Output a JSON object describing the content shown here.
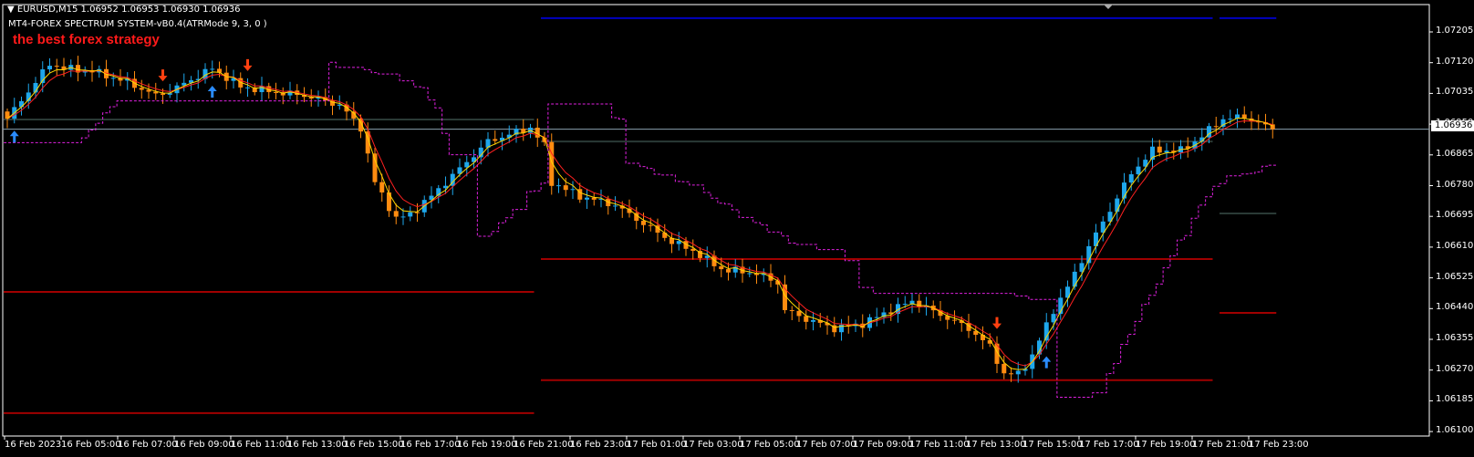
{
  "header": {
    "symbol_line": "EURUSD,M15  1.06952 1.06953 1.06930 1.06936",
    "indicator_line": "MT4-FOREX SPECTRUM SYSTEM-vB0.4(ATRMode 9, 3, 0 )",
    "promo_text": "the best forex strategy"
  },
  "current_price": "1.06936",
  "colors": {
    "background": "#000000",
    "bull": "#1ea7ec",
    "bear": "#ff8c10",
    "ma_fast": "#ffd700",
    "ma_slow": "#ff2020",
    "band": "#e020e0",
    "level_blue": "#0000c0",
    "level_red": "#a00000",
    "level_gray": "#2a3a36",
    "price_line": "#8aa0b0",
    "arrow_up": "#2a8cff",
    "arrow_down": "#ff4010"
  },
  "chart_data": {
    "type": "candlestick",
    "title": "EURUSD,M15",
    "bar_count": 180,
    "ylim": [
      1.061,
      1.07205
    ],
    "y_ticks": [
      "1.07205",
      "1.07120",
      "1.07035",
      "1.06950",
      "1.06865",
      "1.06780",
      "1.06695",
      "1.06610",
      "1.06525",
      "1.06440",
      "1.06355",
      "1.06270",
      "1.06185",
      "1.06100"
    ],
    "x_ticks": [
      "16 Feb 2023",
      "16 Feb 05:00",
      "16 Feb 07:00",
      "16 Feb 09:00",
      "16 Feb 11:00",
      "16 Feb 13:00",
      "16 Feb 15:00",
      "16 Feb 17:00",
      "16 Feb 19:00",
      "16 Feb 21:00",
      "16 Feb 23:00",
      "17 Feb 01:00",
      "17 Feb 03:00",
      "17 Feb 05:00",
      "17 Feb 07:00",
      "17 Feb 09:00",
      "17 Feb 11:00",
      "17 Feb 13:00",
      "17 Feb 15:00",
      "17 Feb 17:00",
      "17 Feb 19:00",
      "17 Feb 21:00",
      "17 Feb 23:00"
    ],
    "close_path": [
      [
        0,
        1.06965
      ],
      [
        6,
        1.07117
      ],
      [
        8,
        1.07104
      ],
      [
        12,
        1.07097
      ],
      [
        17,
        1.07066
      ],
      [
        21,
        1.07029
      ],
      [
        23,
        1.07041
      ],
      [
        29,
        1.07104
      ],
      [
        33,
        1.07054
      ],
      [
        37,
        1.07041
      ],
      [
        42,
        1.07029
      ],
      [
        47,
        1.07003
      ],
      [
        50,
        1.0694
      ],
      [
        52,
        1.06789
      ],
      [
        55,
        1.06688
      ],
      [
        57,
        1.06701
      ],
      [
        60,
        1.06751
      ],
      [
        64,
        1.06827
      ],
      [
        68,
        1.06902
      ],
      [
        72,
        1.06928
      ],
      [
        74,
        1.0694
      ],
      [
        76,
        1.0689
      ],
      [
        77,
        1.06789
      ],
      [
        81,
        1.06751
      ],
      [
        86,
        1.06726
      ],
      [
        90,
        1.06675
      ],
      [
        94,
        1.06625
      ],
      [
        97,
        1.066
      ],
      [
        101,
        1.06549
      ],
      [
        106,
        1.06537
      ],
      [
        109,
        1.06511
      ],
      [
        110,
        1.06436
      ],
      [
        113,
        1.06411
      ],
      [
        117,
        1.06385
      ],
      [
        121,
        1.06398
      ],
      [
        125,
        1.06436
      ],
      [
        128,
        1.06461
      ],
      [
        132,
        1.06423
      ],
      [
        136,
        1.06385
      ],
      [
        139,
        1.06335
      ],
      [
        141,
        1.06259
      ],
      [
        143,
        1.06259
      ],
      [
        145,
        1.0631
      ],
      [
        148,
        1.06436
      ],
      [
        150,
        1.06499
      ],
      [
        153,
        1.06612
      ],
      [
        156,
        1.06713
      ],
      [
        159,
        1.06814
      ],
      [
        162,
        1.06877
      ],
      [
        166,
        1.06877
      ],
      [
        168,
        1.06902
      ],
      [
        172,
        1.06965
      ],
      [
        175,
        1.0697
      ],
      [
        179,
        1.06936
      ]
    ],
    "levels": [
      {
        "price": 1.07243,
        "from_bar": 76,
        "to_bar": 170,
        "color": "blue"
      },
      {
        "price": 1.07243,
        "from_bar": 172,
        "to_bar": 179,
        "color": "blue"
      },
      {
        "price": 1.06963,
        "from_bar": 0,
        "to_bar": 74,
        "color": "gray"
      },
      {
        "price": 1.06902,
        "from_bar": 76,
        "to_bar": 170,
        "color": "gray"
      },
      {
        "price": 1.06703,
        "from_bar": 172,
        "to_bar": 179,
        "color": "gray"
      },
      {
        "price": 1.06486,
        "from_bar": 0,
        "to_bar": 74,
        "color": "red"
      },
      {
        "price": 1.06151,
        "from_bar": 0,
        "to_bar": 74,
        "color": "red"
      },
      {
        "price": 1.06577,
        "from_bar": 76,
        "to_bar": 170,
        "color": "red"
      },
      {
        "price": 1.06242,
        "from_bar": 76,
        "to_bar": 170,
        "color": "red"
      },
      {
        "price": 1.06428,
        "from_bar": 172,
        "to_bar": 179,
        "color": "red"
      }
    ],
    "signals": [
      {
        "bar": 1,
        "type": "buy"
      },
      {
        "bar": 29,
        "type": "buy"
      },
      {
        "bar": 147,
        "type": "buy"
      },
      {
        "bar": 22,
        "type": "sell"
      },
      {
        "bar": 34,
        "type": "sell"
      },
      {
        "bar": 140,
        "type": "sell"
      }
    ]
  }
}
